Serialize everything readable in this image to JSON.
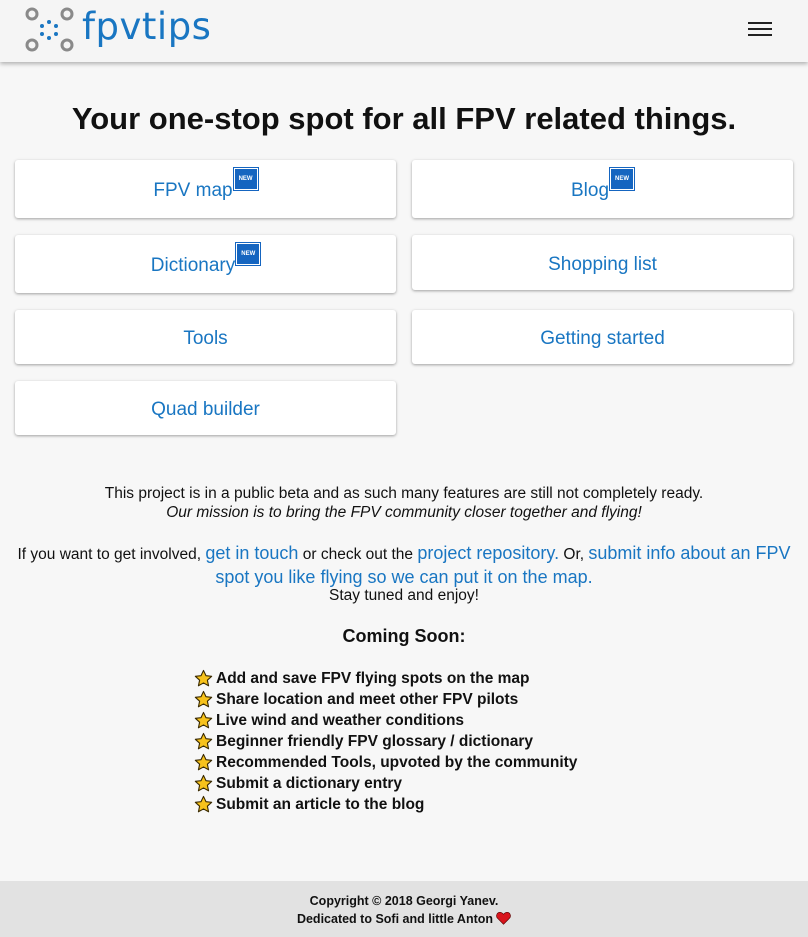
{
  "brand": {
    "name": "fpvtips",
    "accent": "#1976c2"
  },
  "header": {
    "menu_icon": "hamburger-menu-icon"
  },
  "headline": "Your one-stop spot for all FPV related things.",
  "nav_cards": [
    {
      "label": "FPV map",
      "badge": "NEW"
    },
    {
      "label": "Blog",
      "badge": "NEW"
    },
    {
      "label": "Dictionary",
      "badge": "NEW"
    },
    {
      "label": "Shopping list"
    },
    {
      "label": "Tools"
    },
    {
      "label": "Getting started"
    },
    {
      "label": "Quad builder"
    }
  ],
  "intro": {
    "beta": "This project is in a public beta and as such many features are still not completely ready.",
    "mission": "Our mission is to bring the FPV community closer together and flying!"
  },
  "involve": {
    "prefix": "If you want to get involved,",
    "link_contact": "get in touch",
    "middle": "or check out the",
    "link_repo": "project repository.",
    "or": "Or,",
    "link_submit": "submit info about an FPV spot you like flying so we can put it on the map.",
    "stay_tuned": "Stay tuned and enjoy!"
  },
  "coming_soon": {
    "title": "Coming Soon:",
    "items": [
      "Add and save FPV flying spots on the map",
      "Share location and meet other FPV pilots",
      "Live wind and weather conditions",
      "Beginner friendly FPV glossary / dictionary",
      "Recommended Tools, upvoted by the community",
      "Submit a dictionary entry",
      "Submit an article to the blog"
    ]
  },
  "footer": {
    "copyright": "Copyright © 2018 Georgi Yanev.",
    "dedication": "Dedicated to Sofi and little Anton"
  }
}
